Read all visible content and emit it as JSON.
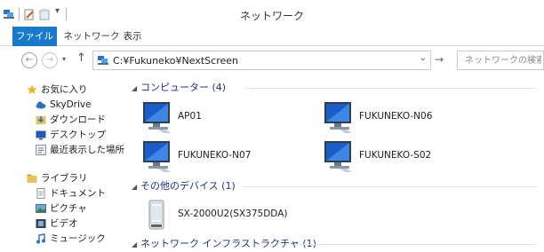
{
  "window": {
    "title": "ネットワーク"
  },
  "ribbon": {
    "tabs": [
      "ファイル",
      "ネットワーク",
      "表示"
    ]
  },
  "address": {
    "path": "C:¥Fukuneko¥NextScreen"
  },
  "search": {
    "placeholder": "ネットワークの検索"
  },
  "nav": {
    "favorites": [
      {
        "label": "お気に入り",
        "icon": "star-icon"
      },
      {
        "label": "SkyDrive",
        "icon": "cloud-icon"
      },
      {
        "label": "ダウンロード",
        "icon": "download-icon"
      },
      {
        "label": "デスクトップ",
        "icon": "desktop-icon"
      },
      {
        "label": "最近表示した場所",
        "icon": "recent-places-icon"
      }
    ],
    "libraries": [
      {
        "label": "ライブラリ",
        "icon": "library-icon"
      },
      {
        "label": "ドキュメント",
        "icon": "document-icon"
      },
      {
        "label": "ピクチャ",
        "icon": "picture-icon"
      },
      {
        "label": "ビデオ",
        "icon": "video-icon"
      },
      {
        "label": "ミュージック",
        "icon": "music-icon"
      }
    ]
  },
  "groups": [
    {
      "title": "コンピューター (4)",
      "items": [
        "AP01",
        "FUKUNEKO-N06",
        "FUKUNEKO-N07",
        "FUKUNEKO-S02"
      ]
    },
    {
      "title": "その他のデバイス (1)",
      "items": [
        "SX-2000U2(SX375DDA)"
      ]
    },
    {
      "title": "ネットワーク インフラストラクチャ (1)",
      "items": []
    }
  ],
  "colors": {
    "accent": "#1979ca",
    "group_heading": "#1e3287"
  }
}
